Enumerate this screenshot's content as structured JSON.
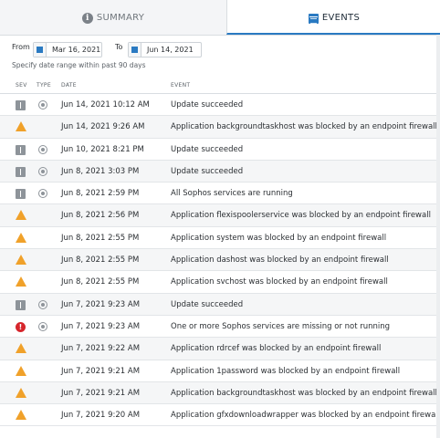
{
  "tabs": [
    {
      "label": "SUMMARY",
      "icon": "info-icon",
      "active": false
    },
    {
      "label": "EVENTS",
      "icon": "calendar-icon",
      "active": true
    }
  ],
  "filter": {
    "from_label": "From",
    "from_value": "Mar 16, 2021",
    "to_label": "To",
    "to_value": "Jun 14, 2021",
    "hint": "Specify date range within past 90 days"
  },
  "columns": {
    "sev": "SEV",
    "type": "TYPE",
    "date": "DATE",
    "event": "EVENT"
  },
  "colors": {
    "accent": "#2a7ac2",
    "warning": "#f0a12a",
    "critical": "#d6262c",
    "info": "#8e949a"
  },
  "events": [
    {
      "sev": "info",
      "type": true,
      "date": "Jun 14, 2021 10:12 AM",
      "event": "Update succeeded"
    },
    {
      "sev": "warning",
      "type": false,
      "date": "Jun 14, 2021 9:26 AM",
      "event": "Application backgroundtaskhost was blocked by an endpoint firewall"
    },
    {
      "sev": "info",
      "type": true,
      "date": "Jun 10, 2021 8:21 PM",
      "event": "Update succeeded"
    },
    {
      "sev": "info",
      "type": true,
      "date": "Jun 8, 2021 3:03 PM",
      "event": "Update succeeded"
    },
    {
      "sev": "info",
      "type": true,
      "date": "Jun 8, 2021 2:59 PM",
      "event": "All Sophos services are running"
    },
    {
      "sev": "warning",
      "type": false,
      "date": "Jun 8, 2021 2:56 PM",
      "event": "Application flexispoolerservice was blocked by an endpoint firewall"
    },
    {
      "sev": "warning",
      "type": false,
      "date": "Jun 8, 2021 2:55 PM",
      "event": "Application system was blocked by an endpoint firewall"
    },
    {
      "sev": "warning",
      "type": false,
      "date": "Jun 8, 2021 2:55 PM",
      "event": "Application dashost was blocked by an endpoint firewall"
    },
    {
      "sev": "warning",
      "type": false,
      "date": "Jun 8, 2021 2:55 PM",
      "event": "Application svchost was blocked by an endpoint firewall"
    },
    {
      "sev": "info",
      "type": true,
      "date": "Jun 7, 2021 9:23 AM",
      "event": "Update succeeded"
    },
    {
      "sev": "critical",
      "type": true,
      "date": "Jun 7, 2021 9:23 AM",
      "event": "One or more Sophos services are missing or not running"
    },
    {
      "sev": "warning",
      "type": false,
      "date": "Jun 7, 2021 9:22 AM",
      "event": "Application rdrcef was blocked by an endpoint firewall"
    },
    {
      "sev": "warning",
      "type": false,
      "date": "Jun 7, 2021 9:21 AM",
      "event": "Application 1password was blocked by an endpoint firewall"
    },
    {
      "sev": "warning",
      "type": false,
      "date": "Jun 7, 2021 9:21 AM",
      "event": "Application backgroundtaskhost was blocked by an endpoint firewall"
    },
    {
      "sev": "warning",
      "type": false,
      "date": "Jun 7, 2021 9:20 AM",
      "event": "Application gfxdownloadwrapper was blocked by an endpoint firewall"
    }
  ]
}
